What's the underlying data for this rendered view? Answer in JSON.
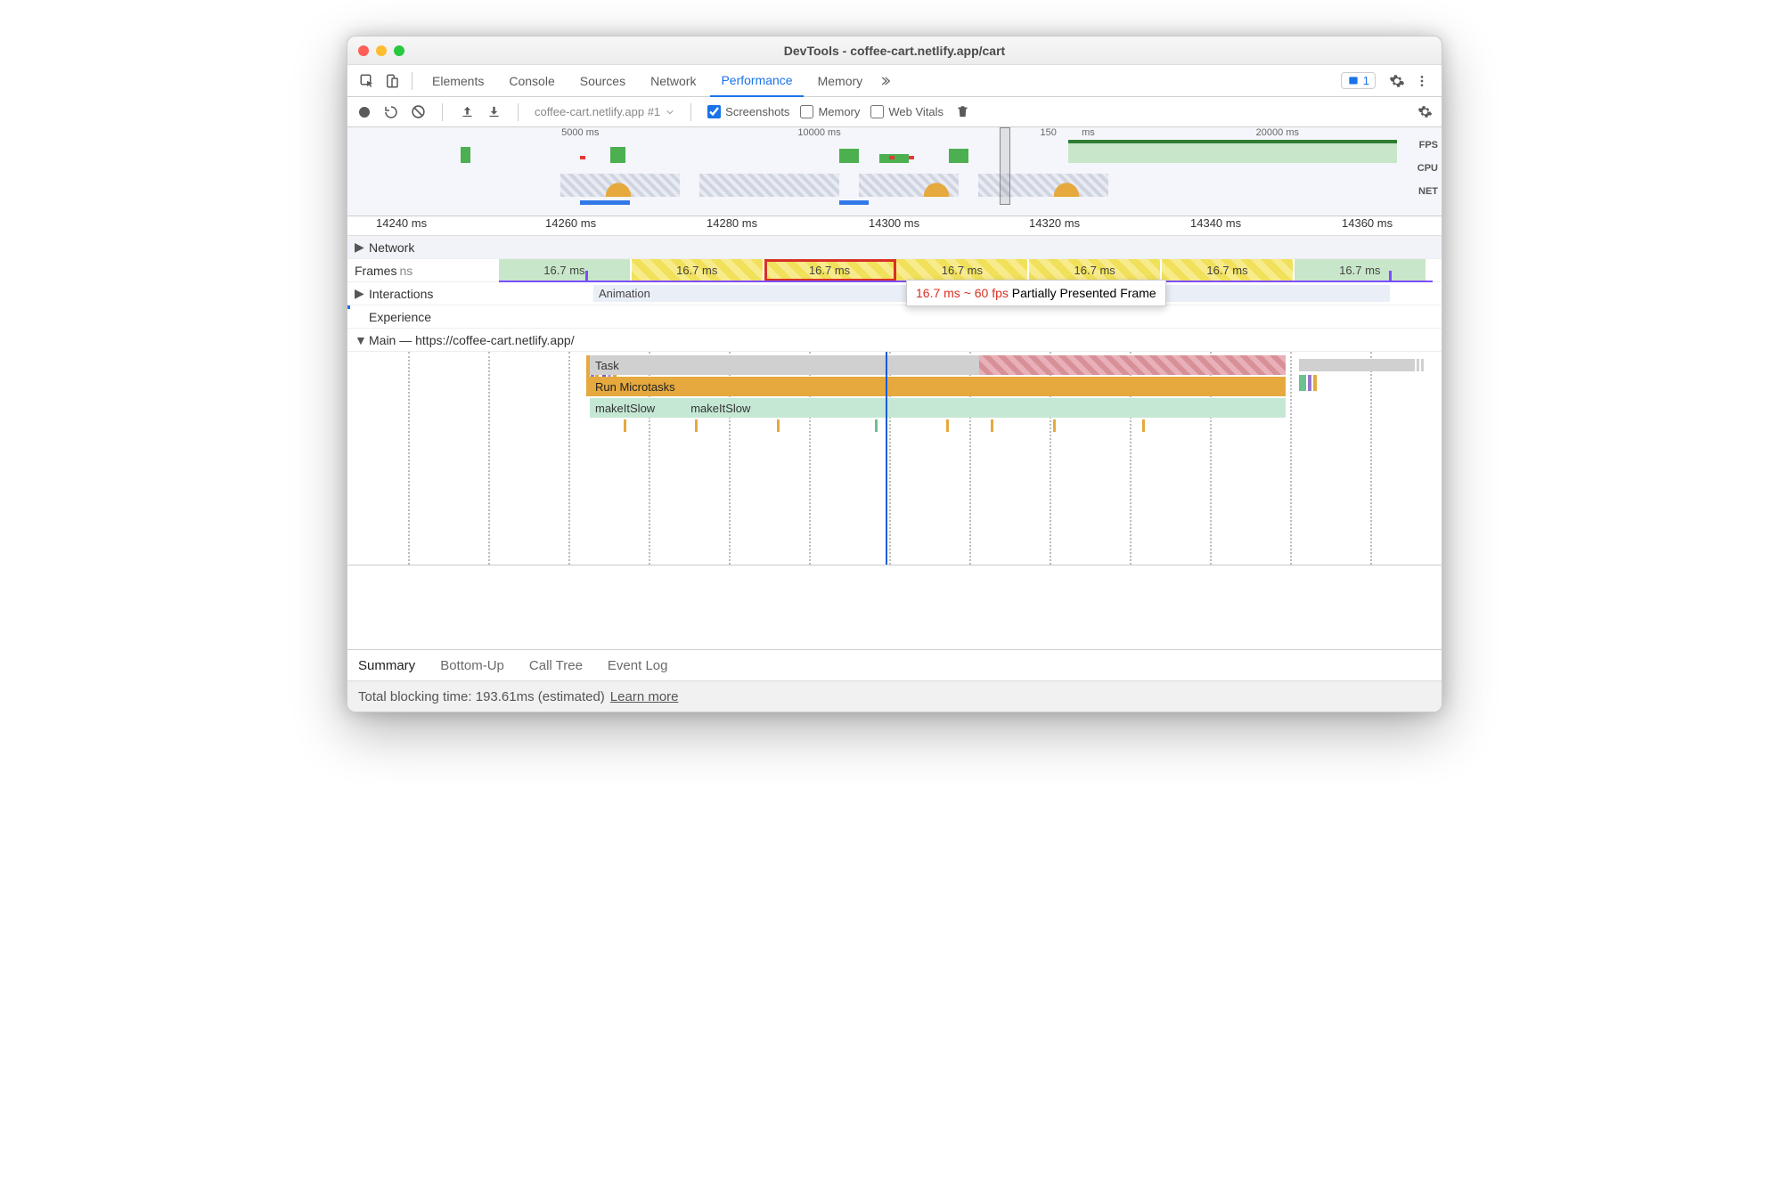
{
  "title": "DevTools - coffee-cart.netlify.app/cart",
  "panels": [
    "Elements",
    "Console",
    "Sources",
    "Network",
    "Performance",
    "Memory"
  ],
  "activePanel": "Performance",
  "issueCount": "1",
  "recording": {
    "name": "coffee-cart.netlify.app #1"
  },
  "checkboxes": {
    "screenshots": "Screenshots",
    "memory": "Memory",
    "webvitals": "Web Vitals"
  },
  "overview": {
    "ticks": [
      "5000 ms",
      "10000 ms",
      "150",
      "ms",
      "20000 ms"
    ],
    "lanes": {
      "fps": "FPS",
      "cpu": "CPU",
      "net": "NET"
    }
  },
  "ruler": [
    "14240 ms",
    "14260 ms",
    "14280 ms",
    "14300 ms",
    "14320 ms",
    "14340 ms",
    "14360 ms"
  ],
  "rows": {
    "network": "Network",
    "frames": "Frames",
    "framesSuffix": "ns",
    "interactions": "Interactions",
    "animation": "Animation",
    "experience": "Experience",
    "main": "Main — https://coffee-cart.netlify.app/"
  },
  "frames": [
    "16.7 ms",
    "16.7 ms",
    "16.7 ms",
    "16.7 ms",
    "16.7 ms",
    "16.7 ms",
    "16.7 ms"
  ],
  "tooltip": {
    "ms": "16.7 ms ~ 60 fps",
    "label": "Partially Presented Frame"
  },
  "flame": {
    "task": "Task",
    "micro": "Run Microtasks",
    "func1": "makeItSlow",
    "func2": "makeItSlow"
  },
  "bottomTabs": [
    "Summary",
    "Bottom-Up",
    "Call Tree",
    "Event Log"
  ],
  "footer": {
    "text": "Total blocking time: 193.61ms (estimated)",
    "link": "Learn more"
  }
}
